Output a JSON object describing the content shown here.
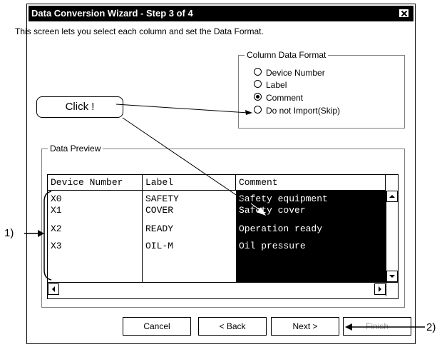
{
  "dialog": {
    "title": "Data Conversion Wizard - Step 3 of 4",
    "intro": "This screen lets you select each column and set the Data Format."
  },
  "column_format": {
    "legend": "Column Data Format",
    "options": [
      {
        "label": "Device Number",
        "checked": false
      },
      {
        "label": "Label",
        "checked": false
      },
      {
        "label": "Comment",
        "checked": true
      },
      {
        "label": "Do not Import(Skip)",
        "checked": false
      }
    ]
  },
  "preview": {
    "legend": "Data Preview",
    "headers": [
      "Device Number",
      "Label",
      "Comment"
    ],
    "rows": [
      [
        "X0",
        "SAFETY",
        "Safety equipment"
      ],
      [
        "X1",
        "COVER",
        "Safety cover"
      ],
      [
        "X2",
        "READY",
        "Operation ready"
      ],
      [
        "X3",
        "OIL-M",
        "Oil pressure"
      ]
    ]
  },
  "buttons": {
    "cancel": "Cancel",
    "back": "< Back",
    "next": "Next >",
    "finish": "Finish"
  },
  "annotations": {
    "click_callout": "Click !",
    "marker_1": "1)",
    "marker_2": "2)"
  }
}
